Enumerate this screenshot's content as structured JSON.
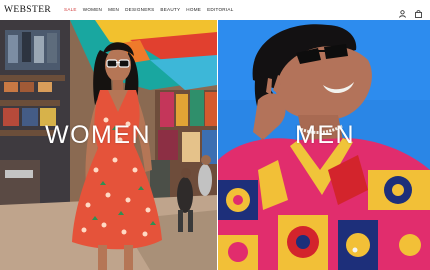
{
  "header": {
    "logo": "WEBSTER",
    "nav": [
      {
        "label": "SALE"
      },
      {
        "label": "WOMEN"
      },
      {
        "label": "MEN"
      },
      {
        "label": "DESIGNERS"
      },
      {
        "label": "BEAUTY"
      },
      {
        "label": "HOME"
      },
      {
        "label": "EDITORIAL"
      }
    ],
    "icons": [
      "user-icon",
      "shopping-bag-icon"
    ]
  },
  "hero": {
    "women": {
      "label": "WOMEN"
    },
    "men": {
      "label": "MEN"
    }
  },
  "colors": {
    "sale": "#d23c3c",
    "sky": "#2a86e6",
    "dress": "#e5533a",
    "shirt": "#e12d6d"
  }
}
